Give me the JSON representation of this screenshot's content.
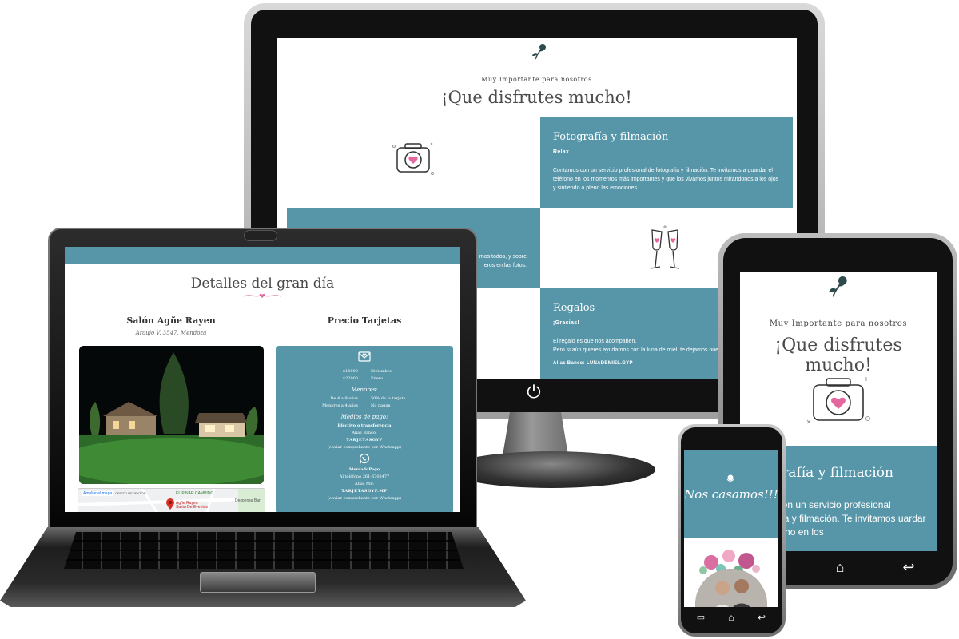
{
  "monitor": {
    "subtitle": "Muy Importante para nosotros",
    "title": "¡Que disfrutes mucho!",
    "panel1": {
      "heading": "Fotografía y filmación",
      "tag": "Relax",
      "text": "Contamos con un servicio profesional de fotografía y filmación. Te invitamos a guardar el teléfono en los momentos más importantes y que los vivamos juntos mirándonos a los ojos y sintiendo a pleno las emociones."
    },
    "panel2": {
      "text": "mos todos, y sobre\neros en las fotos."
    },
    "panel3": {
      "heading": "Regalos",
      "tag": "¡Gracias!",
      "line1": "El regalo es que nos acompañen.",
      "line2": "Pero si aún quieres ayudarnos con la luna de miel, te dejamos nuestro",
      "alias": "Alias Banco: LUNADEMIEL.GYP"
    }
  },
  "laptop": {
    "title": "Detalles del gran día",
    "venue": "Salón Agñe Rayen",
    "address": "Araujo V. 3547, Mendoza",
    "precio_heading": "Precio Tarjetas",
    "prices": [
      {
        "amount": "$18000",
        "month": "Diciembre"
      },
      {
        "amount": "$22000",
        "month": "Enero"
      }
    ],
    "menores_label": "Menores:",
    "menores": [
      {
        "age": "De 4 a 9 años",
        "price": "50% de la tarjeta"
      },
      {
        "age": "Menores a 4 años",
        "price": "No pagan"
      }
    ],
    "medios_label": "Medios de pago:",
    "efectivo": {
      "title": "Efectivo o transferencia",
      "alias_label": "Alias Banco:",
      "alias": "TARJETASGYP",
      "note": "(enviar comprobante por Whatsapp)"
    },
    "mercadopago": {
      "title": "MercadoPago",
      "phone": "Al teléfono 261-6703477",
      "alias_label": "Alias MP:",
      "alias": "TARJETASGYP.MP",
      "note": "(enviar comprobante por Whatsapp)"
    },
    "map": {
      "link": "Ampliar el mapa",
      "place1": "Agñe Rayen",
      "place1b": "Salón De Eventos",
      "place2": "EL PINAR CAMPING",
      "place3": "CRISTO REDENTOR",
      "place4": "Despensa Bart"
    }
  },
  "tablet": {
    "subtitle": "Muy Importante para nosotros",
    "title": "¡Que disfrutes mucho!",
    "panel_heading": "otografía y filmación",
    "panel_text": "amos con un servicio profesional otografía y filmación. Te invitamos uardar el teléfono en los"
  },
  "phone": {
    "hero_text": "Nos casamos!!!"
  },
  "colors": {
    "accent": "#5796a8",
    "heart": "#e4679f",
    "text_dark": "#4a4a4a"
  },
  "icons": {
    "power": "power-icon",
    "home": "home-icon",
    "back": "back-icon",
    "recent": "recent-apps-icon",
    "camera": "camera-heart-icon",
    "glasses": "champagne-glasses-icon",
    "rose": "rose-icon",
    "whatsapp": "whatsapp-icon",
    "envelope": "envelope-heart-icon",
    "map_pin": "map-pin-icon"
  }
}
